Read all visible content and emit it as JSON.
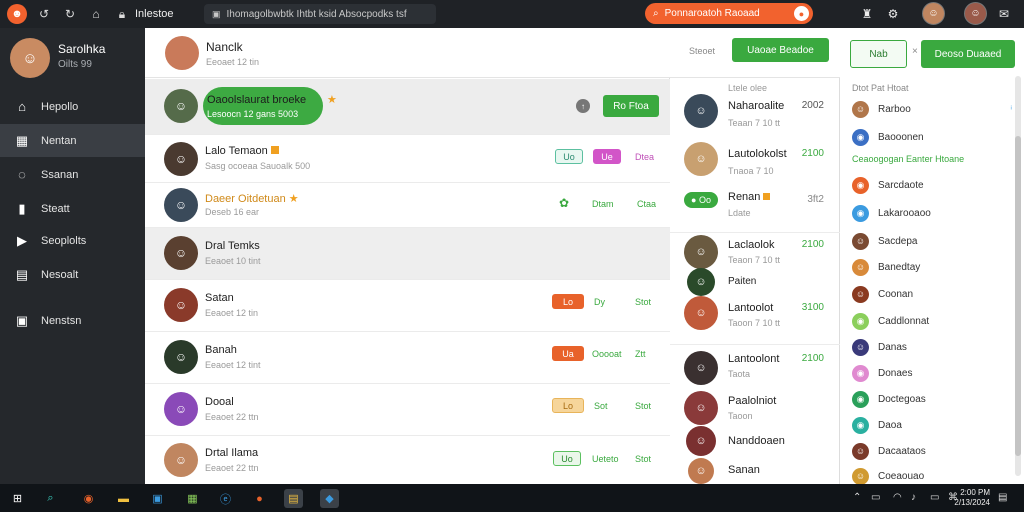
{
  "topbar": {
    "title": "Inlestoe",
    "address": "Ihomagolbwbtk Ihtbt ksid Absocpodks tsf",
    "search_text": "Ponnaroatoh Raoaad",
    "accent": "#f2622e"
  },
  "sidebar": {
    "user_name": "Sarolhka",
    "user_status": "Oilts 99",
    "items": [
      {
        "label": "Hepollo",
        "icon": "home-icon"
      },
      {
        "label": "Nentan",
        "icon": "briefcase-icon"
      },
      {
        "label": "Ssanan",
        "icon": "chat-icon"
      },
      {
        "label": "Steatt",
        "icon": "calendar-icon"
      },
      {
        "label": "Seoplolts",
        "icon": "video-icon"
      },
      {
        "label": "Nesoalt",
        "icon": "store-icon"
      },
      {
        "label": "Nenstsn",
        "icon": "inbox-icon"
      }
    ]
  },
  "main_header": {
    "name": "Nanclk",
    "sub": "Eeoaet 12 tin",
    "status": "Steoet",
    "primary_button": "Uaoae Beadoe"
  },
  "contacts": [
    {
      "name": "Oaoolslaurat broeke",
      "sub": "Lesoocn 12 gans 5003"
    },
    {
      "name": "Lalo Temaon",
      "sub": "Sasg ocoeaa Sauoalk 500",
      "tags": [
        "Uo",
        "Ue",
        "Dtea"
      ]
    },
    {
      "name": "Daeer Oitdetuan",
      "sub": "Deseb 16 ear",
      "tags": [
        "",
        "Dtam",
        "Ctaa"
      ]
    },
    {
      "name": "Dral Temks",
      "sub": "Eeaoet 10 tint"
    },
    {
      "name": "Satan",
      "sub": "Eeaoet 12 tin",
      "tags": [
        "Lo",
        "Dy",
        "Stot"
      ]
    },
    {
      "name": "Banah",
      "sub": "Eeaoet 12 tint",
      "tags": [
        "Ua",
        "Ooooat",
        "Ztt"
      ]
    },
    {
      "name": "Dooal",
      "sub": "Eeaoet 22 ttn",
      "tags": [
        "Lo",
        "Sot",
        "Stot"
      ]
    },
    {
      "name": "Drtal Ilama",
      "sub": "Eeaoet 22 ttn",
      "tags": [
        "Uo",
        "Ueteto",
        "Stot"
      ]
    }
  ],
  "main_actions": {
    "selected_button": "Ro Ftoa"
  },
  "mid_panel": {
    "header": "Ltele olee",
    "rows": [
      {
        "name": "Naharoalite",
        "sub": "Teaan 7 10 tt",
        "num": "2002"
      },
      {
        "name": "Lautolokolst",
        "sub": "Tnaoa 7 10",
        "num": "2100"
      },
      {
        "name": "Renan",
        "sub": "Ldate",
        "num": "3ft2",
        "badge": "Oo"
      },
      {
        "name": "Laclaolok",
        "sub": "Teaon 7 10 tt",
        "num": "2100"
      },
      {
        "name": "Paiten",
        "sub": "Tnta"
      },
      {
        "name": "Lantoolot",
        "sub": "Taoon 7 10 tt",
        "num": "3100"
      },
      {
        "name": "Lantoolont",
        "sub": "Taota",
        "num": "2100"
      },
      {
        "name": "Paalolniot",
        "sub": "Taoon"
      },
      {
        "name": "Nanddoaen",
        "sub": "Naoam"
      },
      {
        "name": "Sanan",
        "sub": ""
      }
    ]
  },
  "right_panel": {
    "tab_label": "Nab",
    "close_label": "×",
    "button": "Deoso Duaaed",
    "head1": "Dtot Pat Htoat",
    "head2": "Ceaoogogan Eanter Htoane",
    "items": [
      {
        "label": "Rarboo",
        "color": "#b0764a"
      },
      {
        "label": "Baooonen",
        "color": "#3b6fc4"
      },
      {
        "label": "Sarcdaote",
        "color": "#e8622a"
      },
      {
        "label": "Lakarooaoo",
        "color": "#3b9be0"
      },
      {
        "label": "Sacdepa",
        "color": "#7a4a32"
      },
      {
        "label": "Banedtay",
        "color": "#d88a3a"
      },
      {
        "label": "Coonan",
        "color": "#8a3a20"
      },
      {
        "label": "Caddlonnat",
        "color": "#8bcf5c"
      },
      {
        "label": "Danas",
        "color": "#3a3a7a"
      },
      {
        "label": "Donaes",
        "color": "#e08ad0"
      },
      {
        "label": "Doctegoas",
        "color": "#2aa05a"
      },
      {
        "label": "Daoa",
        "color": "#2ab0a0"
      },
      {
        "label": "Dacaataos",
        "color": "#7a3a2a"
      },
      {
        "label": "Coeaouao",
        "color": "#d09a30"
      }
    ]
  },
  "taskbar": {
    "time": "2:00 PM",
    "date": "2/13/2024"
  },
  "colors": {
    "green": "#3aa93f",
    "orange": "#f08a24",
    "sidebar": "#25282c"
  }
}
